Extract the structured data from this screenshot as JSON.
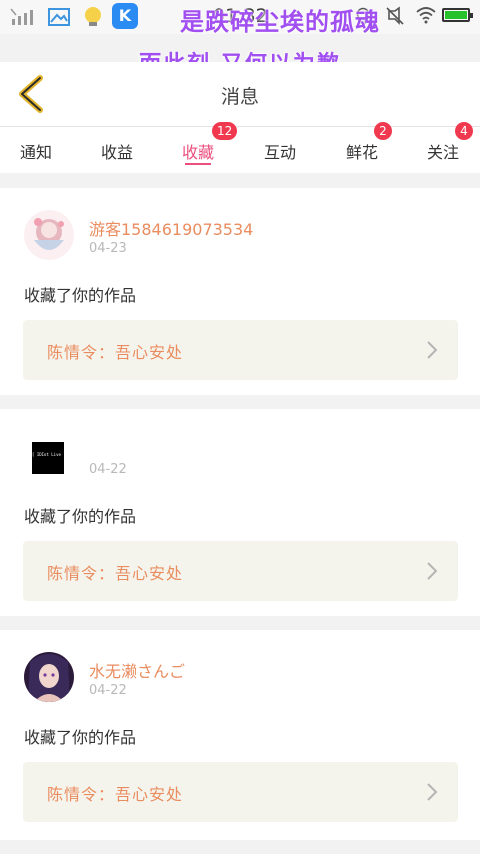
{
  "status_bar": {
    "time": "01:32",
    "icons": [
      "signal-icon",
      "image-icon",
      "bulb-notification-icon",
      "k-app-icon",
      "bulb-icon",
      "mute-icon",
      "wifi-icon",
      "battery-icon"
    ],
    "k_label": "K",
    "battery_level": 1.0,
    "battery_color": "#27c22b"
  },
  "banner": {
    "line1": "是跌碎尘埃的孤魂",
    "line2": "而此刻 又何以为歉",
    "color": "#a14ff0"
  },
  "header": {
    "title": "消息",
    "back_icon": "back-arrow-icon",
    "back_color": "#e3b52d"
  },
  "tabs": [
    {
      "label": "通知",
      "badge": "",
      "active": false
    },
    {
      "label": "收益",
      "badge": "",
      "active": false
    },
    {
      "label": "收藏",
      "badge": "12",
      "active": true
    },
    {
      "label": "互动",
      "badge": "",
      "active": false
    },
    {
      "label": "鲜花",
      "badge": "2",
      "active": false
    },
    {
      "label": "关注",
      "badge": "4",
      "active": false
    }
  ],
  "accent_color": "#ea4f7d",
  "badge_color": "#f0394f",
  "notifications": [
    {
      "username": "游客1584619073534",
      "date": "04-23",
      "action": "收藏了你的作品",
      "work_title": "陈情令：吾心安处",
      "avatar": "anime-girl-avatar"
    },
    {
      "username": "",
      "date": "04-22",
      "action": "收藏了你的作品",
      "work_title": "陈情令：吾心安处",
      "avatar": "black-square-avatar",
      "avatar_text": "[ IDIot Live ]"
    },
    {
      "username": "水无濑さんご",
      "date": "04-22",
      "action": "收藏了你的作品",
      "work_title": "陈情令：吾心安处",
      "avatar": "dark-hair-girl-avatar"
    }
  ]
}
